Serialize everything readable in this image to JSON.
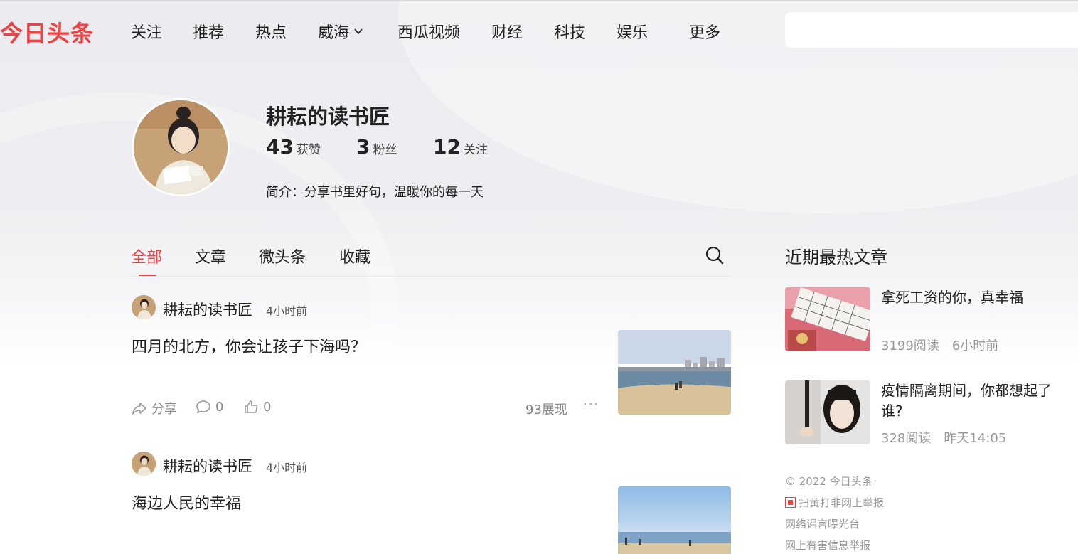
{
  "header": {
    "logo_text": "今日头条",
    "nav": [
      {
        "label": "关注"
      },
      {
        "label": "推荐"
      },
      {
        "label": "热点"
      },
      {
        "label": "威海"
      },
      {
        "label": "西瓜视频"
      },
      {
        "label": "财经"
      },
      {
        "label": "科技"
      },
      {
        "label": "娱乐"
      },
      {
        "label": "更多"
      }
    ],
    "search_placeholder": ""
  },
  "profile": {
    "name": "耕耘的读书匠",
    "stats": [
      {
        "value": "43",
        "label": "获赞"
      },
      {
        "value": "3",
        "label": "粉丝"
      },
      {
        "value": "12",
        "label": "关注"
      }
    ],
    "bio": "简介：分享书里好句，温暖你的每一天"
  },
  "tabs": [
    {
      "label": "全部",
      "active": true
    },
    {
      "label": "文章",
      "active": false
    },
    {
      "label": "微头条",
      "active": false
    },
    {
      "label": "收藏",
      "active": false
    }
  ],
  "feed": [
    {
      "author": "耕耘的读书匠",
      "time": "4小时前",
      "title": "四月的北方，你会让孩子下海吗？",
      "actions": {
        "share": "分享",
        "comments": "0",
        "likes": "0"
      },
      "views": "93展现",
      "more": "···"
    },
    {
      "author": "耕耘的读书匠",
      "time": "4小时前",
      "title": "海边人民的幸福"
    }
  ],
  "sidebar": {
    "title": "近期最热文章",
    "articles": [
      {
        "title": "拿死工资的你，真幸福",
        "reads": "3199阅读",
        "time": "6小时前"
      },
      {
        "title": "疫情隔离期间，你都想起了谁?",
        "reads": "328阅读",
        "time": "昨天14:05"
      }
    ],
    "footer": [
      "© 2022 今日头条",
      "扫黄打非网上举报",
      "网络谣言曝光台",
      "网上有害信息举报"
    ]
  },
  "colors": {
    "accent": "#f04142"
  }
}
